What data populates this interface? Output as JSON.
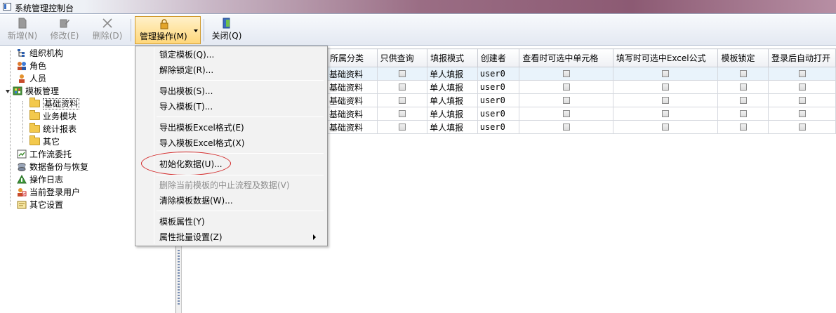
{
  "window": {
    "title": "系统管理控制台"
  },
  "toolbar": {
    "new_label": "新增(N)",
    "edit_label": "修改(E)",
    "delete_label": "删除(D)",
    "manage_label": "管理操作(M)",
    "close_label": "关闭(Q)"
  },
  "tree": {
    "items": [
      {
        "label": "组织机构",
        "icon": "org-icon"
      },
      {
        "label": "角色",
        "icon": "role-icon"
      },
      {
        "label": "人员",
        "icon": "person-icon"
      },
      {
        "label": "模板管理",
        "icon": "template-icon"
      },
      {
        "label": "基础资料",
        "icon": "folder-icon"
      },
      {
        "label": "业务模块",
        "icon": "folder-icon"
      },
      {
        "label": "统计报表",
        "icon": "folder-icon"
      },
      {
        "label": "其它",
        "icon": "folder-icon"
      },
      {
        "label": "工作流委托",
        "icon": "workflow-icon"
      },
      {
        "label": "数据备份与恢复",
        "icon": "backup-icon"
      },
      {
        "label": "操作日志",
        "icon": "log-icon"
      },
      {
        "label": "当前登录用户",
        "icon": "user-login-icon"
      },
      {
        "label": "其它设置",
        "icon": "settings-icon"
      }
    ]
  },
  "grid": {
    "columns": [
      "所属分类",
      "只供查询",
      "填报模式",
      "创建者",
      "查看时可选中单元格",
      "填写时可选中Excel公式",
      "模板锁定",
      "登录后自动打开"
    ],
    "rows": [
      {
        "category": "基础资料",
        "mode": "单人填报",
        "creator": "user0"
      },
      {
        "category": "基础资料",
        "mode": "单人填报",
        "creator": "user0"
      },
      {
        "category": "基础资料",
        "mode": "单人填报",
        "creator": "user0"
      },
      {
        "category": "基础资料",
        "mode": "单人填报",
        "creator": "user0"
      },
      {
        "category": "基础资料",
        "mode": "单人填报",
        "creator": "user0"
      }
    ]
  },
  "menu": {
    "lock": "锁定模板(Q)...",
    "unlock": "解除锁定(R)...",
    "export": "导出模板(S)...",
    "import": "导入模板(T)...",
    "export_excel": "导出模板Excel格式(E)",
    "import_excel": "导入模板Excel格式(X)",
    "init_data": "初始化数据(U)...",
    "delete_aborted": "删除当前模板的中止流程及数据(V)",
    "clear_data": "清除模板数据(W)...",
    "properties": "模板属性(Y)",
    "batch_props": "属性批量设置(Z)"
  },
  "colors": {
    "highlight_oval": "#d32a2a",
    "menu_bg": "#f2f2f2",
    "active_button": "#ffd77a"
  }
}
